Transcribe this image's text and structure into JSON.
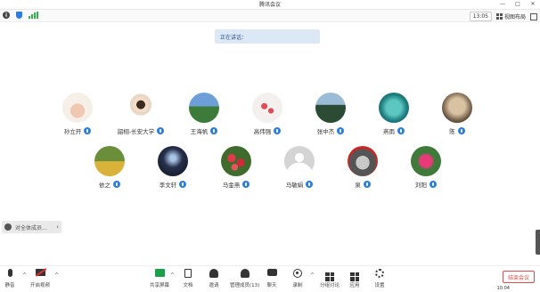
{
  "window": {
    "title": "腾讯会议",
    "controls": [
      "—",
      "□",
      "✕"
    ]
  },
  "status_bar": {
    "timer": "13:05",
    "layout_label": "视图布局"
  },
  "banner": {
    "text": "正在讲话："
  },
  "participants_row1": [
    {
      "name": "孙立开",
      "avatar": "avatar-photo-1"
    },
    {
      "name": "韶栩-长安大学",
      "avatar": "avatar-cartoon-girl"
    },
    {
      "name": "王海帆",
      "avatar": "avatar-landscape"
    },
    {
      "name": "高伟强",
      "avatar": "avatar-flowers"
    },
    {
      "name": "张中杰",
      "avatar": "avatar-mountain"
    },
    {
      "name": "燕雨",
      "avatar": "avatar-ocean"
    },
    {
      "name": "陈",
      "avatar": "avatar-dog"
    }
  ],
  "participants_row2": [
    {
      "name": "依之",
      "avatar": "avatar-field"
    },
    {
      "name": "李文轩",
      "avatar": "avatar-night-sky"
    },
    {
      "name": "马金燕",
      "avatar": "avatar-roses"
    },
    {
      "name": "马敏娟",
      "avatar": "avatar-default"
    },
    {
      "name": "泉",
      "avatar": "avatar-man"
    },
    {
      "name": "刘阳",
      "avatar": "avatar-flower-pink"
    }
  ],
  "chat_toast": {
    "text": "对全体成员..."
  },
  "toolbar": {
    "items": [
      {
        "label": "静音",
        "icon": "microphone-icon"
      },
      {
        "label": "开启视频",
        "icon": "camera-off-icon"
      },
      {
        "label": "共享屏幕",
        "icon": "share-screen-icon"
      },
      {
        "label": "文档",
        "icon": "document-icon"
      },
      {
        "label": "邀请",
        "icon": "invite-icon"
      },
      {
        "label": "管理成员(13)",
        "icon": "members-icon"
      },
      {
        "label": "聊天",
        "icon": "chat-icon"
      },
      {
        "label": "录制",
        "icon": "record-icon"
      },
      {
        "label": "分组讨论",
        "icon": "breakout-icon"
      },
      {
        "label": "应用",
        "icon": "apps-icon"
      },
      {
        "label": "设置",
        "icon": "settings-icon"
      }
    ],
    "leave_label": "结束会议"
  },
  "clock": "10:04"
}
